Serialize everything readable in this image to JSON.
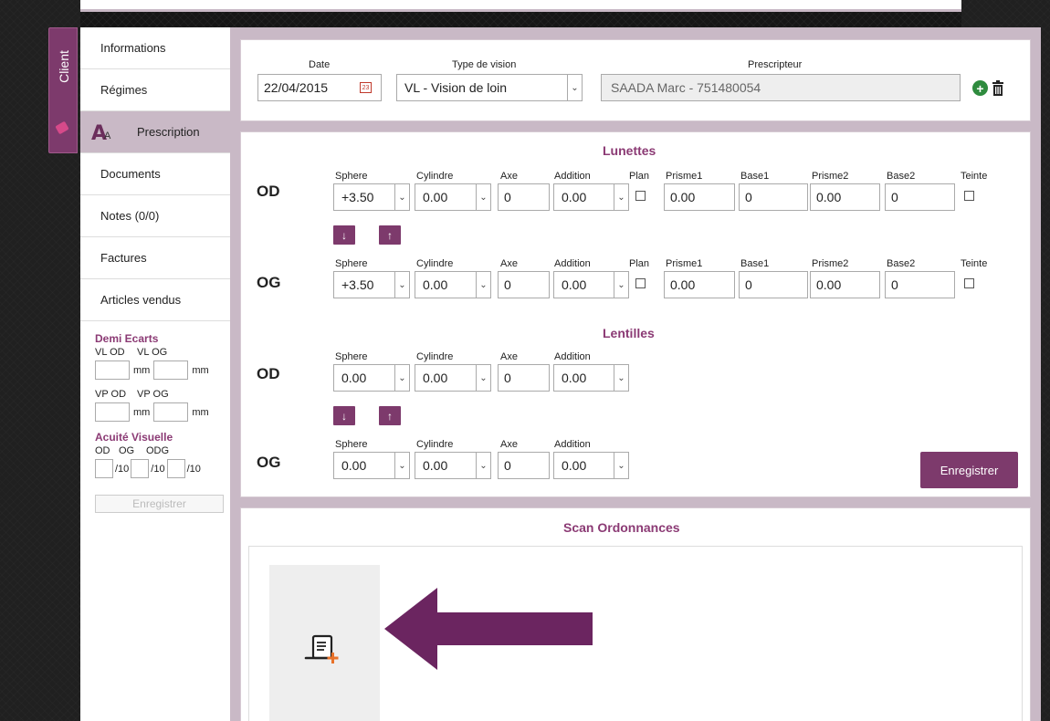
{
  "client_tab": {
    "label": "Client"
  },
  "sidebar": {
    "items": [
      {
        "label": "Informations"
      },
      {
        "label": "Régimes"
      },
      {
        "label": "Prescription"
      },
      {
        "label": "Documents"
      },
      {
        "label": "Notes (0/0)"
      },
      {
        "label": "Factures"
      },
      {
        "label": "Articles vendus"
      }
    ],
    "demi_ecarts": {
      "title": "Demi Ecarts",
      "vl_od": "VL OD",
      "vl_og": "VL OG",
      "vp_od": "VP OD",
      "vp_og": "VP OG",
      "unit": "mm"
    },
    "acuite": {
      "title": "Acuité Visuelle",
      "od": "OD",
      "og": "OG",
      "odg": "ODG",
      "unit": "/10"
    },
    "save_label": "Enregistrer"
  },
  "header": {
    "date_label": "Date",
    "date_value": "22/04/2015",
    "type_label": "Type de vision",
    "type_value": "VL - Vision de loin",
    "prescripteur_label": "Prescripteur",
    "prescripteur_value": "SAADA Marc - 751480054"
  },
  "lunettes": {
    "title": "Lunettes",
    "labels": {
      "sphere": "Sphere",
      "cylindre": "Cylindre",
      "axe": "Axe",
      "addition": "Addition",
      "plan": "Plan",
      "prisme1": "Prisme1",
      "base1": "Base1",
      "prisme2": "Prisme2",
      "base2": "Base2",
      "teinte": "Teinte"
    },
    "od": {
      "eye": "OD",
      "sphere": "+3.50",
      "cylindre": "0.00",
      "axe": "0",
      "addition": "0.00",
      "prisme1": "0.00",
      "base1": "0",
      "prisme2": "0.00",
      "base2": "0"
    },
    "og": {
      "eye": "OG",
      "sphere": "+3.50",
      "cylindre": "0.00",
      "axe": "0",
      "addition": "0.00",
      "prisme1": "0.00",
      "base1": "0",
      "prisme2": "0.00",
      "base2": "0"
    }
  },
  "lentilles": {
    "title": "Lentilles",
    "labels": {
      "sphere": "Sphere",
      "cylindre": "Cylindre",
      "axe": "Axe",
      "addition": "Addition"
    },
    "od": {
      "eye": "OD",
      "sphere": "0.00",
      "cylindre": "0.00",
      "axe": "0",
      "addition": "0.00"
    },
    "og": {
      "eye": "OG",
      "sphere": "0.00",
      "cylindre": "0.00",
      "axe": "0",
      "addition": "0.00"
    }
  },
  "copy_buttons": {
    "down": "↓",
    "up": "↑"
  },
  "save_label": "Enregistrer",
  "scan": {
    "title": "Scan Ordonnances"
  },
  "colors": {
    "accent": "#7d3a6c",
    "section_title": "#8b3a74",
    "panel_bg": "#c9b9c6",
    "arrow": "#6b2560"
  }
}
